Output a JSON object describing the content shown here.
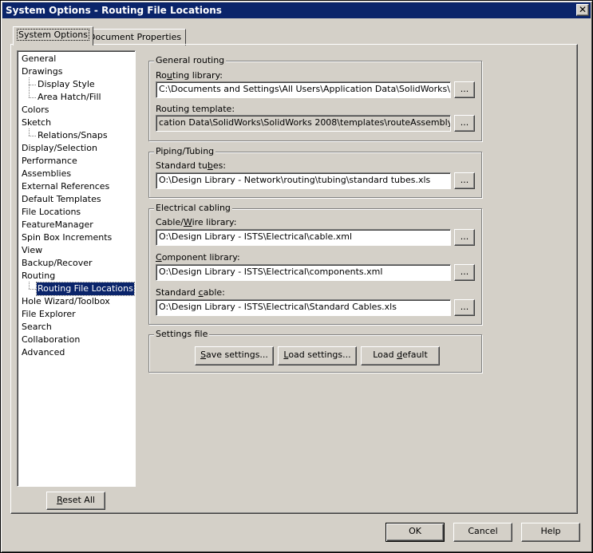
{
  "window": {
    "title": "System Options - Routing File Locations",
    "close_glyph": "✕"
  },
  "tabs": [
    {
      "label": "System Options",
      "active": true
    },
    {
      "label": "Document Properties",
      "active": false
    }
  ],
  "tree": {
    "items": [
      {
        "label": "General",
        "level": 0
      },
      {
        "label": "Drawings",
        "level": 0
      },
      {
        "label": "Display Style",
        "level": 1
      },
      {
        "label": "Area Hatch/Fill",
        "level": 1
      },
      {
        "label": "Colors",
        "level": 0
      },
      {
        "label": "Sketch",
        "level": 0
      },
      {
        "label": "Relations/Snaps",
        "level": 1
      },
      {
        "label": "Display/Selection",
        "level": 0
      },
      {
        "label": "Performance",
        "level": 0
      },
      {
        "label": "Assemblies",
        "level": 0
      },
      {
        "label": "External References",
        "level": 0
      },
      {
        "label": "Default Templates",
        "level": 0
      },
      {
        "label": "File Locations",
        "level": 0
      },
      {
        "label": "FeatureManager",
        "level": 0
      },
      {
        "label": "Spin Box Increments",
        "level": 0
      },
      {
        "label": "View",
        "level": 0
      },
      {
        "label": "Backup/Recover",
        "level": 0
      },
      {
        "label": "Routing",
        "level": 0
      },
      {
        "label": "Routing File Locations",
        "level": 1,
        "selected": true
      },
      {
        "label": "Hole Wizard/Toolbox",
        "level": 0
      },
      {
        "label": "File Explorer",
        "level": 0
      },
      {
        "label": "Search",
        "level": 0
      },
      {
        "label": "Collaboration",
        "level": 0
      },
      {
        "label": "Advanced",
        "level": 0
      }
    ]
  },
  "reset_all": {
    "pre": "",
    "mn": "R",
    "post": "eset All"
  },
  "general_routing": {
    "title": "General routing",
    "library_label": {
      "pre": "Ro",
      "mn": "u",
      "post": "ting library:"
    },
    "library_value": "C:\\Documents and Settings\\All Users\\Application Data\\SolidWorks\\SolidWor",
    "template_label": "Routing template:",
    "template_value": "cation Data\\SolidWorks\\SolidWorks 2008\\templates\\routeAssembly.asmdot"
  },
  "piping": {
    "title": "Piping/Tubing",
    "tubes_label": {
      "pre": "Standard tu",
      "mn": "b",
      "post": "es:"
    },
    "tubes_value": "O:\\Design Library - Network\\routing\\tubing\\standard tubes.xls"
  },
  "electrical": {
    "title": "Electrical cabling",
    "wire_label": {
      "pre": "Cable/",
      "mn": "W",
      "post": "ire library:"
    },
    "wire_value": "O:\\Design Library - ISTS\\Electrical\\cable.xml",
    "component_label": {
      "pre": "",
      "mn": "C",
      "post": "omponent library:"
    },
    "component_value": "O:\\Design Library - ISTS\\Electrical\\components.xml",
    "cable_label": {
      "pre": "Standard ",
      "mn": "c",
      "post": "able:"
    },
    "cable_value": "O:\\Design Library - ISTS\\Electrical\\Standard Cables.xls"
  },
  "settings_file": {
    "title": "Settings file",
    "save": {
      "pre": "",
      "mn": "S",
      "post": "ave settings..."
    },
    "load": {
      "pre": "",
      "mn": "L",
      "post": "oad settings..."
    },
    "load_default": {
      "pre": "Load ",
      "mn": "d",
      "post": "efault"
    }
  },
  "browse_label": "...",
  "footer": {
    "ok": "OK",
    "cancel": "Cancel",
    "help": "Help"
  }
}
